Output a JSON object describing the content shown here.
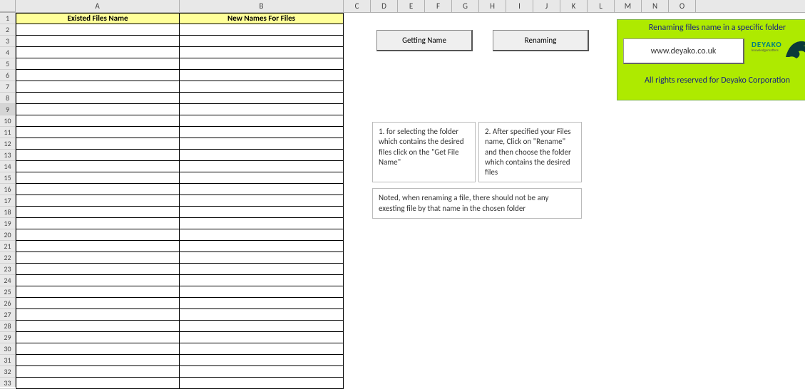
{
  "columns": [
    "A",
    "B",
    "C",
    "D",
    "E",
    "F",
    "G",
    "H",
    "I",
    "J",
    "K",
    "L",
    "M",
    "N",
    "O"
  ],
  "rows": [
    "1",
    "2",
    "3",
    "4",
    "5",
    "6",
    "7",
    "8",
    "9",
    "10",
    "11",
    "12",
    "13",
    "14",
    "15",
    "16",
    "17",
    "18",
    "19",
    "20",
    "21",
    "22",
    "23",
    "24",
    "25",
    "26",
    "27",
    "28",
    "29",
    "30",
    "31",
    "32",
    "33"
  ],
  "selectedRow": "9",
  "mainTable": {
    "headerA": "Existed Files Name",
    "headerB": "New Names For Files",
    "numDataRows": 32
  },
  "buttons": {
    "gettingName": "Getting Name",
    "renaming": "Renaming"
  },
  "info": {
    "title": "Renaming files name in a specific folder",
    "website": "www.deyako.co.uk",
    "brandName": "DEYAKO",
    "brandTag": "knowledgematters",
    "rights": "All rights reserved for Deyako Corporation"
  },
  "instructions": {
    "box1": "1. for selecting the folder which contains the desired files click on the \"Get File Name\"",
    "box2": "2. After specified your Files name, Click on \"Rename\" and then choose the folder which contains the desired files",
    "note": "Noted, when renaming a file, there should not be any exesting file by that name in the chosen folder"
  }
}
